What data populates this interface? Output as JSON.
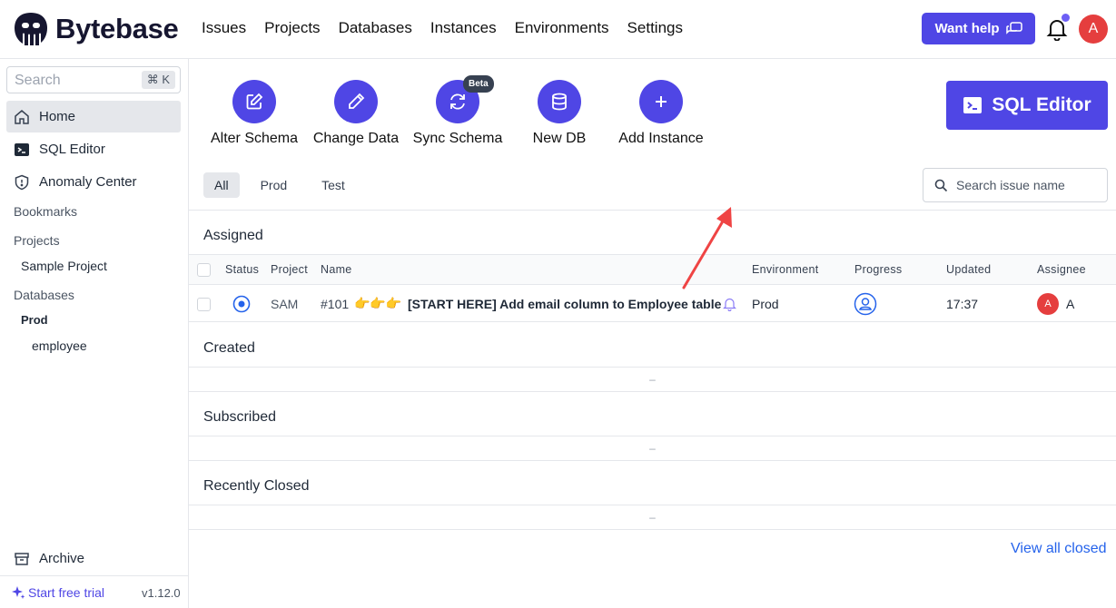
{
  "app": {
    "name": "Bytebase",
    "nav": [
      "Issues",
      "Projects",
      "Databases",
      "Instances",
      "Environments",
      "Settings"
    ],
    "want_help": "Want help",
    "user_initial": "A"
  },
  "sidebar": {
    "search_placeholder": "Search",
    "search_shortcut": "⌘ K",
    "items": [
      {
        "label": "Home",
        "icon": "home-icon"
      },
      {
        "label": "SQL Editor",
        "icon": "terminal-icon"
      },
      {
        "label": "Anomaly Center",
        "icon": "shield-icon"
      }
    ],
    "bookmarks_label": "Bookmarks",
    "projects_label": "Projects",
    "project_item": "Sample Project",
    "databases_label": "Databases",
    "db_env": "Prod",
    "db_item": "employee",
    "archive": "Archive",
    "trial": "Start free trial",
    "version": "v1.12.0"
  },
  "quick_actions": [
    {
      "label": "Alter Schema",
      "icon": "edit-icon"
    },
    {
      "label": "Change Data",
      "icon": "pencil-icon"
    },
    {
      "label": "Sync Schema",
      "icon": "sync-icon"
    },
    {
      "label": "New DB",
      "icon": "database-icon"
    },
    {
      "label": "Add Instance",
      "icon": "plus-icon"
    }
  ],
  "beta_badge": "Beta",
  "sql_editor_button": "SQL Editor",
  "env_tabs": [
    "All",
    "Prod",
    "Test"
  ],
  "issue_search_placeholder": "Search issue name",
  "sections": {
    "assigned": "Assigned",
    "created": "Created",
    "subscribed": "Subscribed",
    "recently_closed": "Recently Closed"
  },
  "table": {
    "columns": [
      "Status",
      "Project",
      "Name",
      "Environment",
      "Progress",
      "Updated",
      "Assignee"
    ],
    "row": {
      "project": "SAM",
      "number": "#101",
      "emoji": "👉👉👉",
      "title": "[START HERE] Add email column to Employee table",
      "environment": "Prod",
      "updated": "17:37",
      "assignee_initial": "A",
      "assignee": "A"
    }
  },
  "empty_marker": "–",
  "view_all_closed": "View all closed",
  "colors": {
    "accent": "#4f46e5",
    "avatar": "#e53e3e",
    "link": "#2563eb",
    "annotation_arrow": "#ef4444"
  }
}
